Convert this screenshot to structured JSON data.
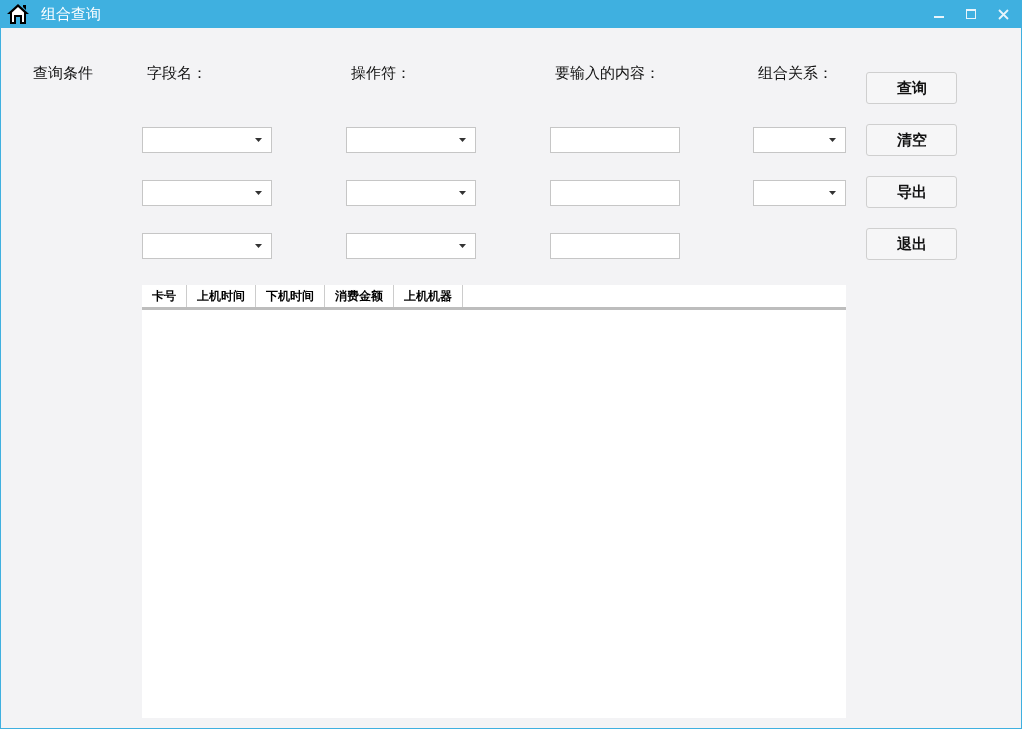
{
  "window": {
    "title": "组合查询"
  },
  "condition_label": "查询条件",
  "headings": [
    "字段名：",
    "操作符：",
    "要输入的内容：",
    "组合关系："
  ],
  "table": {
    "columns": [
      "卡号",
      "上机时间",
      "下机时间",
      "消费金额",
      "上机机器"
    ]
  },
  "buttons": [
    "查询",
    "清空",
    "导出",
    "退出"
  ]
}
